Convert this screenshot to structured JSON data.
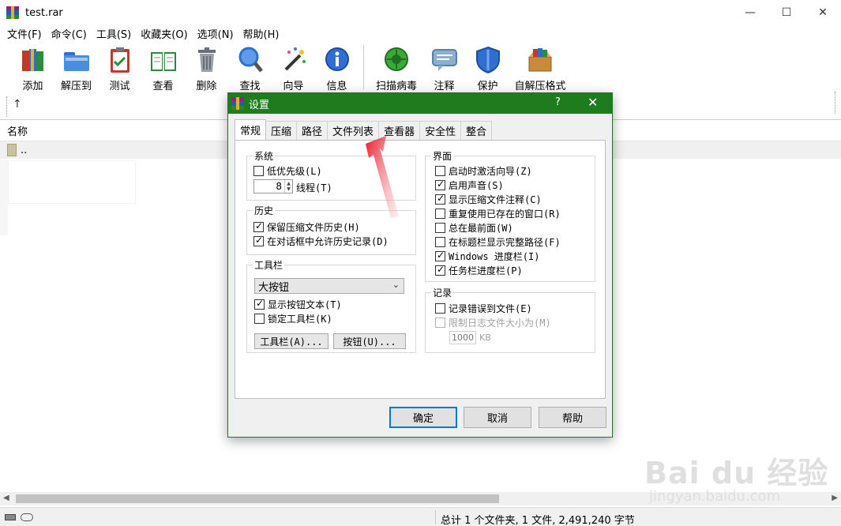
{
  "window": {
    "title": "test.rar",
    "controls": {
      "minimize": "—",
      "maximize": "☐",
      "close": "✕"
    }
  },
  "menubar": [
    "文件(F)",
    "命令(C)",
    "工具(S)",
    "收藏夹(O)",
    "选项(N)",
    "帮助(H)"
  ],
  "toolbar": [
    {
      "label": "添加",
      "icon": "books-icon",
      "color": "#c0392b"
    },
    {
      "label": "解压到",
      "icon": "folder-icon",
      "color": "#3a7bd5"
    },
    {
      "label": "测试",
      "icon": "clipboard-check-icon",
      "color": "#c0392b"
    },
    {
      "label": "查看",
      "icon": "book-icon",
      "color": "#2e8b3a"
    },
    {
      "label": "删除",
      "icon": "trash-icon",
      "color": "#7a7f88"
    },
    {
      "label": "查找",
      "icon": "magnifier-icon",
      "color": "#2f6fd0"
    },
    {
      "label": "向导",
      "icon": "magic-wand-icon",
      "color": "#6a8fd8"
    },
    {
      "label": "信息",
      "icon": "info-icon",
      "color": "#2f6fd0"
    },
    {
      "label": "扫描病毒",
      "icon": "virus-icon",
      "color": "#3aa83a"
    },
    {
      "label": "注释",
      "icon": "comment-icon",
      "color": "#6b8fb5"
    },
    {
      "label": "保护",
      "icon": "shield-icon",
      "color": "#2f6fd0"
    },
    {
      "label": "自解压格式",
      "icon": "sfx-box-icon",
      "color": "#c98b3a"
    }
  ],
  "nav": {
    "up_icon": "↑"
  },
  "filelist": {
    "column_name": "名称",
    "rows": [
      {
        "name": ".."
      }
    ]
  },
  "statusbar": {
    "text": "总计 1 个文件夹, 1 文件, 2,491,240 字节"
  },
  "dialog": {
    "title": "设置",
    "help": "?",
    "close": "✕",
    "tabs": [
      "常规",
      "压缩",
      "路径",
      "文件列表",
      "查看器",
      "安全性",
      "整合"
    ],
    "active_tab": "常规",
    "system": {
      "title": "系统",
      "low_priority": {
        "label": "低优先级(L)",
        "checked": false
      },
      "threads_value": "8",
      "threads_label": "线程(T)"
    },
    "history": {
      "title": "历史",
      "keep_history": {
        "label": "保留压缩文件历史(H)",
        "checked": true
      },
      "allow_dialog_history": {
        "label": "在对话框中允许历史记录(D)",
        "checked": true
      }
    },
    "toolbar_group": {
      "title": "工具栏",
      "select_value": "大按钮",
      "show_text": {
        "label": "显示按钮文本(T)",
        "checked": true
      },
      "lock_toolbar": {
        "label": "锁定工具栏(K)",
        "checked": false
      },
      "toolbar_button": "工具栏(A)...",
      "buttons_button": "按钮(U)..."
    },
    "interface": {
      "title": "界面",
      "items": [
        {
          "label": "启动时激活向导(Z)",
          "checked": false
        },
        {
          "label": "启用声音(S)",
          "checked": true
        },
        {
          "label": "显示压缩文件注释(C)",
          "checked": true
        },
        {
          "label": "重复使用已存在的窗口(R)",
          "checked": false
        },
        {
          "label": "总在最前面(W)",
          "checked": false
        },
        {
          "label": "在标题栏显示完整路径(F)",
          "checked": false
        },
        {
          "label": "Windows 进度栏(I)",
          "checked": true
        },
        {
          "label": "任务栏进度栏(P)",
          "checked": true
        }
      ]
    },
    "log": {
      "title": "记录",
      "log_errors": {
        "label": "记录错误到文件(E)",
        "checked": false
      },
      "limit_size": {
        "label": "限制日志文件大小为(M)",
        "checked": false
      },
      "size_value": "1000",
      "size_unit": "KB"
    },
    "buttons": {
      "ok": "确定",
      "cancel": "取消",
      "help": "帮助"
    }
  },
  "annotation": {
    "arrow_color": "#e8182a"
  },
  "watermark": {
    "main": "Bai du 经验",
    "sub": "jingyan.baidu.com"
  }
}
